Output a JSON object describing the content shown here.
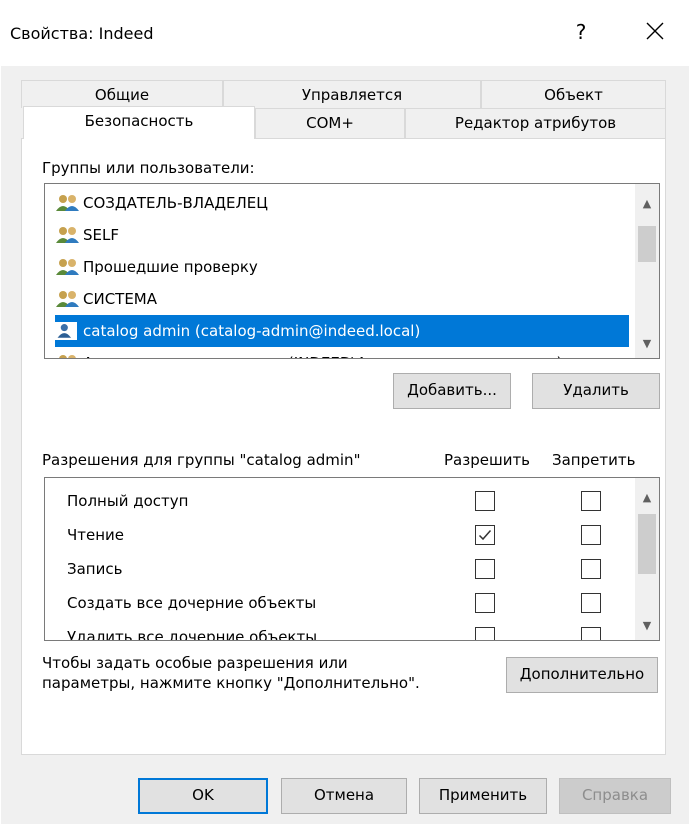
{
  "window": {
    "title": "Свойства: Indeed",
    "help": "?",
    "close": "✕"
  },
  "tabs": {
    "row1": [
      "Общие",
      "Управляется",
      "Объект"
    ],
    "row2": [
      "Безопасность",
      "COM+",
      "Редактор атрибутов"
    ],
    "active": "Безопасность"
  },
  "groups": {
    "label": "Группы или пользователи:",
    "items": [
      {
        "name": "СОЗДАТЕЛЬ-ВЛАДЕЛЕЦ",
        "icon": "group-icon"
      },
      {
        "name": "SELF",
        "icon": "group-icon"
      },
      {
        "name": "Прошедшие проверку",
        "icon": "group-icon"
      },
      {
        "name": "СИСТЕМА",
        "icon": "group-icon"
      },
      {
        "name": "catalog admin (catalog-admin@indeed.local)",
        "icon": "user-icon",
        "selected": true
      },
      {
        "name": "Администраторы домена (INDEED\\Администраторы домена)",
        "icon": "group-icon"
      }
    ],
    "add_button": "Добавить...",
    "remove_button": "Удалить"
  },
  "permissions": {
    "label": "Разрешения для группы \"catalog admin\"",
    "allow_header": "Разрешить",
    "deny_header": "Запретить",
    "items": [
      {
        "name": "Полный доступ",
        "allow": false,
        "deny": false
      },
      {
        "name": "Чтение",
        "allow": true,
        "deny": false
      },
      {
        "name": "Запись",
        "allow": false,
        "deny": false
      },
      {
        "name": "Создать все дочерние объекты",
        "allow": false,
        "deny": false
      },
      {
        "name": "Удалить все дочерние объекты",
        "allow": false,
        "deny": false
      }
    ]
  },
  "advanced": {
    "line1": "Чтобы задать особые разрешения или",
    "line2": "параметры, нажмите кнопку \"Дополнительно\".",
    "button": "Дополнительно"
  },
  "footer": {
    "ok": "OK",
    "cancel": "Отмена",
    "apply": "Применить",
    "help": "Справка"
  },
  "colors": {
    "selection": "#0078d7",
    "dialog_bg": "#f0f0f0",
    "accent": "#0078d7"
  }
}
